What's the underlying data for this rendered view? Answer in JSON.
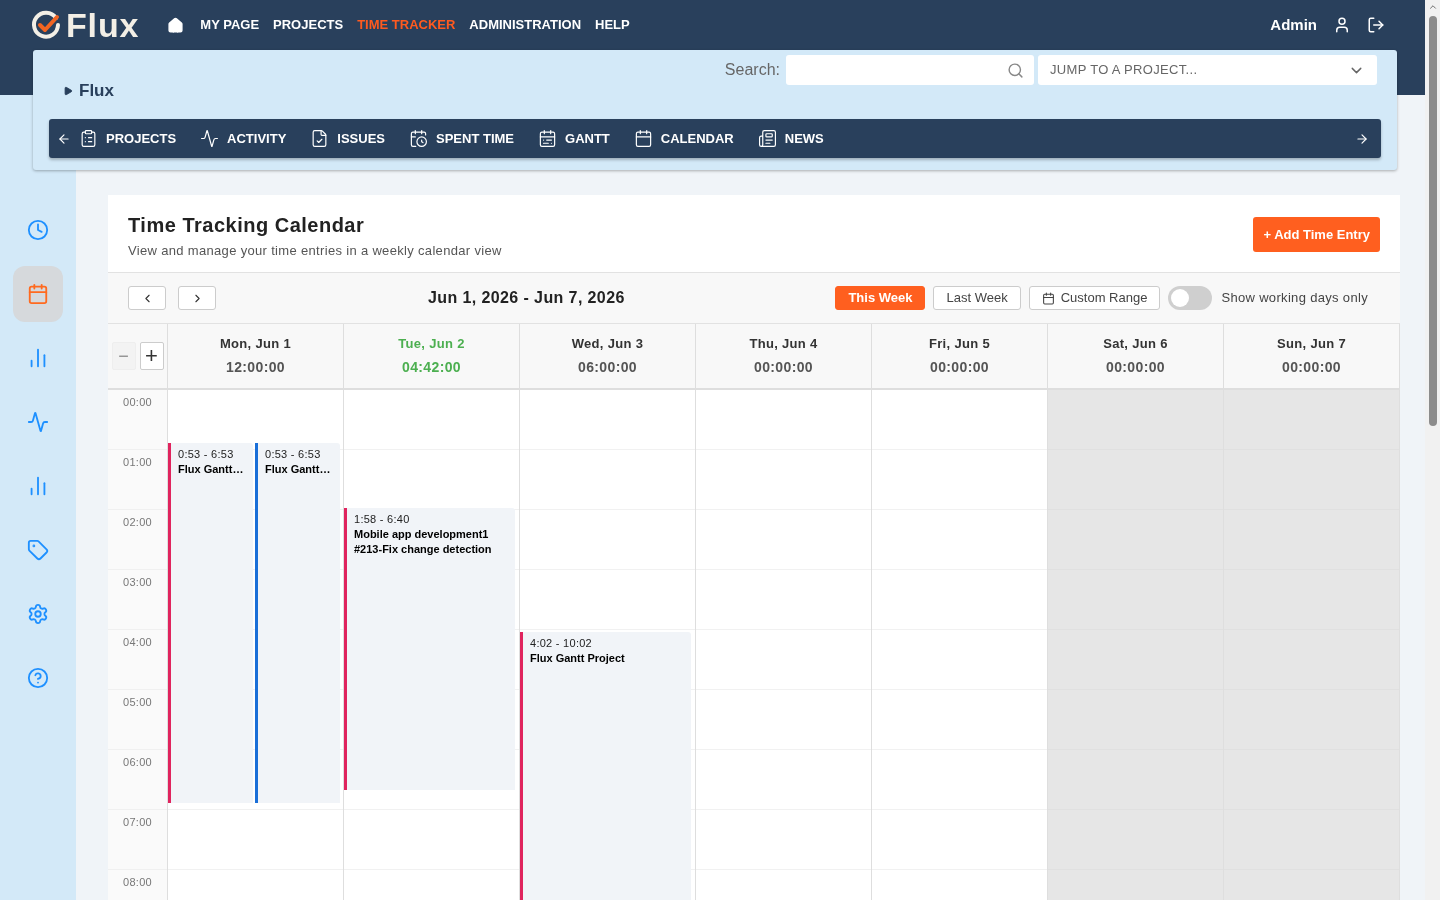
{
  "brand": {
    "name": "Flux"
  },
  "top_nav": [
    {
      "label": "MY PAGE",
      "selected": false
    },
    {
      "label": "PROJECTS",
      "selected": false
    },
    {
      "label": "TIME TRACKER",
      "selected": true
    },
    {
      "label": "ADMINISTRATION",
      "selected": false
    },
    {
      "label": "HELP",
      "selected": false
    }
  ],
  "user": {
    "name": "Admin"
  },
  "project_panel": {
    "breadcrumb": "Flux",
    "search_label": "Search:",
    "jump_placeholder": "JUMP TO A PROJECT...",
    "menu": [
      {
        "label": "PROJECTS",
        "kind": "projects"
      },
      {
        "label": "ACTIVITY",
        "kind": "activity"
      },
      {
        "label": "ISSUES",
        "kind": "issues"
      },
      {
        "label": "SPENT TIME",
        "kind": "spent"
      },
      {
        "label": "GANTT",
        "kind": "gantt"
      },
      {
        "label": "CALENDAR",
        "kind": "calendar"
      },
      {
        "label": "NEWS",
        "kind": "news"
      }
    ]
  },
  "sidebar": {
    "items": [
      {
        "kind": "clock",
        "selected": false
      },
      {
        "kind": "calendar",
        "selected": true
      },
      {
        "kind": "chart",
        "selected": false
      },
      {
        "kind": "activity",
        "selected": false
      },
      {
        "kind": "chart",
        "selected": false
      },
      {
        "kind": "tag",
        "selected": false
      },
      {
        "kind": "settings",
        "selected": false
      },
      {
        "kind": "help",
        "selected": false
      }
    ]
  },
  "calendar": {
    "title": "Time Tracking Calendar",
    "subtitle": "View and manage your time entries in a weekly calendar view",
    "add_button": "+ Add Time Entry",
    "range": "Jun 1, 2026 - Jun 7, 2026",
    "filters": [
      {
        "label": "This Week",
        "selected": true,
        "kind": "plain"
      },
      {
        "label": "Last Week",
        "selected": false,
        "kind": "plain"
      },
      {
        "label": "Custom Range",
        "selected": false,
        "kind": "calendar"
      }
    ],
    "working_days_toggle": {
      "label": "Show working days only",
      "on": false
    },
    "zoom_out": {
      "label": "−",
      "disabled": true
    },
    "zoom_in": {
      "label": "+",
      "disabled": false
    },
    "hours": [
      "00:00",
      "01:00",
      "02:00",
      "03:00",
      "04:00",
      "05:00",
      "06:00",
      "07:00",
      "08:00"
    ],
    "days": [
      {
        "label": "Mon, Jun 1",
        "total": "12:00:00",
        "today": false,
        "weekend": false,
        "entries": [
          {
            "time": "0:53 - 6:53",
            "title": "Flux Gantt…",
            "color": "#e0245e"
          },
          {
            "time": "0:53 - 6:53",
            "title": "Flux Gantt…",
            "color": "#1a6fd8"
          }
        ]
      },
      {
        "label": "Tue, Jun 2",
        "total": "04:42:00",
        "today": true,
        "weekend": false,
        "entries": [
          {
            "time": "1:58 - 6:40",
            "title": "Mobile app development1 #213-Fix change detection",
            "color": "#e0245e"
          }
        ]
      },
      {
        "label": "Wed, Jun 3",
        "total": "06:00:00",
        "today": false,
        "weekend": false,
        "entries": [
          {
            "time": "4:02 - 10:02",
            "title": "Flux Gantt Project",
            "color": "#e0245e"
          }
        ]
      },
      {
        "label": "Thu, Jun 4",
        "total": "00:00:00",
        "today": false,
        "weekend": false
      },
      {
        "label": "Fri, Jun 5",
        "total": "00:00:00",
        "today": false,
        "weekend": false
      },
      {
        "label": "Sat, Jun 6",
        "total": "00:00:00",
        "today": false,
        "weekend": true
      },
      {
        "label": "Sun, Jun 7",
        "total": "00:00:00",
        "today": false,
        "weekend": true
      }
    ]
  }
}
